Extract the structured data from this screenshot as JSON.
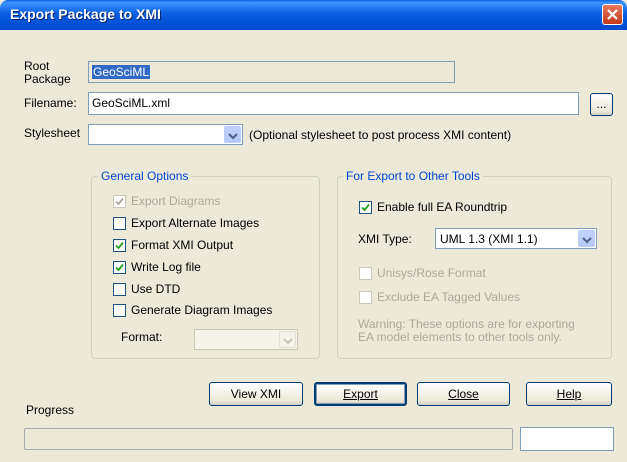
{
  "window": {
    "title": "Export Package to XMI"
  },
  "root_package": {
    "label_line1": "Root",
    "label_line2": "Package",
    "value": "GeoSciML"
  },
  "filename": {
    "label": "Filename:",
    "value": "GeoSciML.xml",
    "browse_label": "..."
  },
  "stylesheet": {
    "label": "Stylesheet",
    "value": "",
    "hint": "(Optional stylesheet to post process XMI content)"
  },
  "general_options": {
    "legend": "General Options",
    "items": [
      {
        "label": "Export Diagrams",
        "checked": true,
        "disabled": true
      },
      {
        "label": "Export Alternate Images",
        "checked": false,
        "disabled": false
      },
      {
        "label": "Format XMI Output",
        "checked": true,
        "disabled": false
      },
      {
        "label": "Write Log file",
        "checked": true,
        "disabled": false
      },
      {
        "label": "Use DTD",
        "checked": false,
        "disabled": false
      },
      {
        "label": "Generate Diagram Images",
        "checked": false,
        "disabled": false
      }
    ],
    "format_label": "Format:",
    "format_value": ""
  },
  "other_tools": {
    "legend": "For Export to Other Tools",
    "roundtrip": {
      "label": "Enable full EA Roundtrip",
      "checked": true
    },
    "xmi_type_label": "XMI Type:",
    "xmi_type_value": "UML 1.3 (XMI 1.1)",
    "unisys": {
      "label": "Unisys/Rose Format",
      "checked": false,
      "disabled": true
    },
    "exclude_tagged": {
      "label": "Exclude EA Tagged Values",
      "checked": false,
      "disabled": true
    },
    "warning_line1": "Warning: These options are for exporting",
    "warning_line2": "EA model elements to other tools only."
  },
  "buttons": {
    "view_xmi": "View XMI",
    "export": "Export",
    "close": "Close",
    "help": "Help"
  },
  "progress": {
    "label": "Progress",
    "percent": 0
  }
}
